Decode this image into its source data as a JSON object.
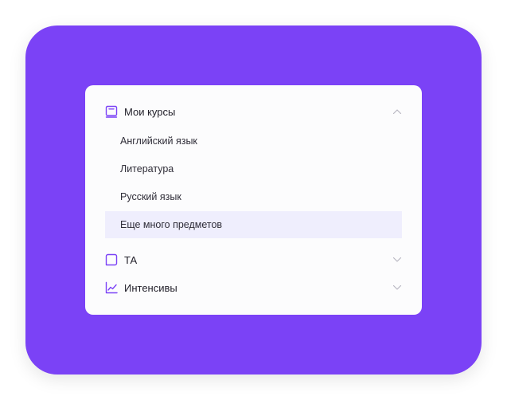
{
  "colors": {
    "frame": "#7b42f6",
    "accent_icon": "#7b42f6",
    "active_bg": "#efeefd",
    "chevron": "#b9b7c2",
    "text": "#23212b"
  },
  "menu": {
    "sections": [
      {
        "label": "Мои курсы",
        "icon": "book-icon",
        "expanded": true,
        "items": [
          {
            "label": "Английский язык",
            "active": false
          },
          {
            "label": "Литература",
            "active": false
          },
          {
            "label": "Русский язык",
            "active": false
          },
          {
            "label": "Еще много предметов",
            "active": true
          }
        ]
      },
      {
        "label": "ТА",
        "icon": "chat-icon",
        "expanded": false
      },
      {
        "label": "Интенсивы",
        "icon": "chart-icon",
        "expanded": false
      }
    ]
  }
}
